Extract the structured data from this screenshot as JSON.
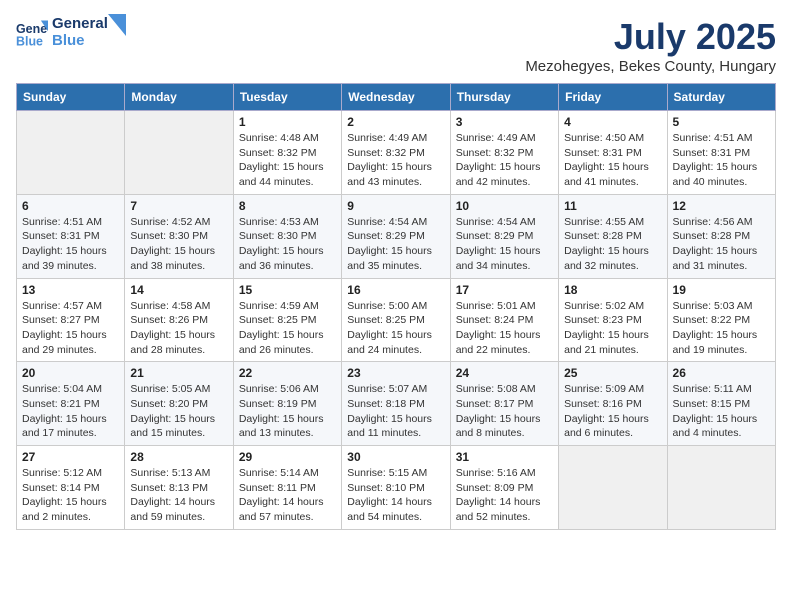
{
  "header": {
    "logo_line1": "General",
    "logo_line2": "Blue",
    "month_title": "July 2025",
    "location": "Mezohegyes, Bekes County, Hungary"
  },
  "weekdays": [
    "Sunday",
    "Monday",
    "Tuesday",
    "Wednesday",
    "Thursday",
    "Friday",
    "Saturday"
  ],
  "weeks": [
    [
      {
        "day": "",
        "sunrise": "",
        "sunset": "",
        "daylight": ""
      },
      {
        "day": "",
        "sunrise": "",
        "sunset": "",
        "daylight": ""
      },
      {
        "day": "1",
        "sunrise": "Sunrise: 4:48 AM",
        "sunset": "Sunset: 8:32 PM",
        "daylight": "Daylight: 15 hours and 44 minutes."
      },
      {
        "day": "2",
        "sunrise": "Sunrise: 4:49 AM",
        "sunset": "Sunset: 8:32 PM",
        "daylight": "Daylight: 15 hours and 43 minutes."
      },
      {
        "day": "3",
        "sunrise": "Sunrise: 4:49 AM",
        "sunset": "Sunset: 8:32 PM",
        "daylight": "Daylight: 15 hours and 42 minutes."
      },
      {
        "day": "4",
        "sunrise": "Sunrise: 4:50 AM",
        "sunset": "Sunset: 8:31 PM",
        "daylight": "Daylight: 15 hours and 41 minutes."
      },
      {
        "day": "5",
        "sunrise": "Sunrise: 4:51 AM",
        "sunset": "Sunset: 8:31 PM",
        "daylight": "Daylight: 15 hours and 40 minutes."
      }
    ],
    [
      {
        "day": "6",
        "sunrise": "Sunrise: 4:51 AM",
        "sunset": "Sunset: 8:31 PM",
        "daylight": "Daylight: 15 hours and 39 minutes."
      },
      {
        "day": "7",
        "sunrise": "Sunrise: 4:52 AM",
        "sunset": "Sunset: 8:30 PM",
        "daylight": "Daylight: 15 hours and 38 minutes."
      },
      {
        "day": "8",
        "sunrise": "Sunrise: 4:53 AM",
        "sunset": "Sunset: 8:30 PM",
        "daylight": "Daylight: 15 hours and 36 minutes."
      },
      {
        "day": "9",
        "sunrise": "Sunrise: 4:54 AM",
        "sunset": "Sunset: 8:29 PM",
        "daylight": "Daylight: 15 hours and 35 minutes."
      },
      {
        "day": "10",
        "sunrise": "Sunrise: 4:54 AM",
        "sunset": "Sunset: 8:29 PM",
        "daylight": "Daylight: 15 hours and 34 minutes."
      },
      {
        "day": "11",
        "sunrise": "Sunrise: 4:55 AM",
        "sunset": "Sunset: 8:28 PM",
        "daylight": "Daylight: 15 hours and 32 minutes."
      },
      {
        "day": "12",
        "sunrise": "Sunrise: 4:56 AM",
        "sunset": "Sunset: 8:28 PM",
        "daylight": "Daylight: 15 hours and 31 minutes."
      }
    ],
    [
      {
        "day": "13",
        "sunrise": "Sunrise: 4:57 AM",
        "sunset": "Sunset: 8:27 PM",
        "daylight": "Daylight: 15 hours and 29 minutes."
      },
      {
        "day": "14",
        "sunrise": "Sunrise: 4:58 AM",
        "sunset": "Sunset: 8:26 PM",
        "daylight": "Daylight: 15 hours and 28 minutes."
      },
      {
        "day": "15",
        "sunrise": "Sunrise: 4:59 AM",
        "sunset": "Sunset: 8:25 PM",
        "daylight": "Daylight: 15 hours and 26 minutes."
      },
      {
        "day": "16",
        "sunrise": "Sunrise: 5:00 AM",
        "sunset": "Sunset: 8:25 PM",
        "daylight": "Daylight: 15 hours and 24 minutes."
      },
      {
        "day": "17",
        "sunrise": "Sunrise: 5:01 AM",
        "sunset": "Sunset: 8:24 PM",
        "daylight": "Daylight: 15 hours and 22 minutes."
      },
      {
        "day": "18",
        "sunrise": "Sunrise: 5:02 AM",
        "sunset": "Sunset: 8:23 PM",
        "daylight": "Daylight: 15 hours and 21 minutes."
      },
      {
        "day": "19",
        "sunrise": "Sunrise: 5:03 AM",
        "sunset": "Sunset: 8:22 PM",
        "daylight": "Daylight: 15 hours and 19 minutes."
      }
    ],
    [
      {
        "day": "20",
        "sunrise": "Sunrise: 5:04 AM",
        "sunset": "Sunset: 8:21 PM",
        "daylight": "Daylight: 15 hours and 17 minutes."
      },
      {
        "day": "21",
        "sunrise": "Sunrise: 5:05 AM",
        "sunset": "Sunset: 8:20 PM",
        "daylight": "Daylight: 15 hours and 15 minutes."
      },
      {
        "day": "22",
        "sunrise": "Sunrise: 5:06 AM",
        "sunset": "Sunset: 8:19 PM",
        "daylight": "Daylight: 15 hours and 13 minutes."
      },
      {
        "day": "23",
        "sunrise": "Sunrise: 5:07 AM",
        "sunset": "Sunset: 8:18 PM",
        "daylight": "Daylight: 15 hours and 11 minutes."
      },
      {
        "day": "24",
        "sunrise": "Sunrise: 5:08 AM",
        "sunset": "Sunset: 8:17 PM",
        "daylight": "Daylight: 15 hours and 8 minutes."
      },
      {
        "day": "25",
        "sunrise": "Sunrise: 5:09 AM",
        "sunset": "Sunset: 8:16 PM",
        "daylight": "Daylight: 15 hours and 6 minutes."
      },
      {
        "day": "26",
        "sunrise": "Sunrise: 5:11 AM",
        "sunset": "Sunset: 8:15 PM",
        "daylight": "Daylight: 15 hours and 4 minutes."
      }
    ],
    [
      {
        "day": "27",
        "sunrise": "Sunrise: 5:12 AM",
        "sunset": "Sunset: 8:14 PM",
        "daylight": "Daylight: 15 hours and 2 minutes."
      },
      {
        "day": "28",
        "sunrise": "Sunrise: 5:13 AM",
        "sunset": "Sunset: 8:13 PM",
        "daylight": "Daylight: 14 hours and 59 minutes."
      },
      {
        "day": "29",
        "sunrise": "Sunrise: 5:14 AM",
        "sunset": "Sunset: 8:11 PM",
        "daylight": "Daylight: 14 hours and 57 minutes."
      },
      {
        "day": "30",
        "sunrise": "Sunrise: 5:15 AM",
        "sunset": "Sunset: 8:10 PM",
        "daylight": "Daylight: 14 hours and 54 minutes."
      },
      {
        "day": "31",
        "sunrise": "Sunrise: 5:16 AM",
        "sunset": "Sunset: 8:09 PM",
        "daylight": "Daylight: 14 hours and 52 minutes."
      },
      {
        "day": "",
        "sunrise": "",
        "sunset": "",
        "daylight": ""
      },
      {
        "day": "",
        "sunrise": "",
        "sunset": "",
        "daylight": ""
      }
    ]
  ]
}
